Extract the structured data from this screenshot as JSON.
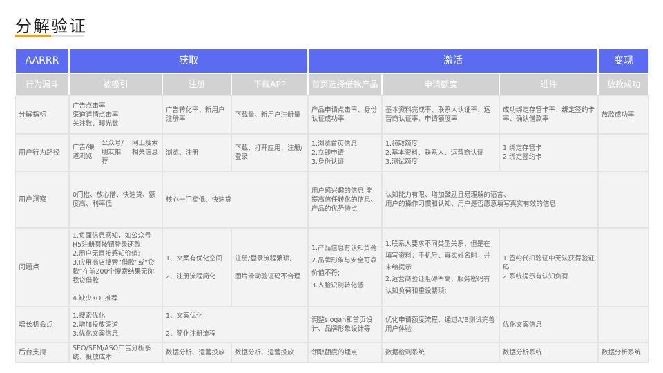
{
  "page": {
    "title": "分解验证"
  },
  "headers": {
    "col0": "AARRR",
    "acq": "获取",
    "act": "激活",
    "rev": "变现"
  },
  "subheaders": {
    "funnel": "行为漏斗",
    "attract": "被吸引",
    "register": "注册",
    "download": "下载APP",
    "home": "首页选择借款产品",
    "apply": "申请额度",
    "card": "进件",
    "loan": "放款成功"
  },
  "rows": {
    "metrics": {
      "label": "分解指标",
      "attract": "广告点击率\n渠道详情点击率\n关注数、曝光数",
      "register": "广告转化率、新用户注册率",
      "download": "下载量、新用户注册量",
      "home": "产品申请点击率、身份认证成功率",
      "apply": "基本资料完成率、联系人认证率、运营商认证率、申请额度率",
      "card": "成功绑定存管卡率、绑定签约卡率、确认借款率",
      "loan": "放款成功率"
    },
    "path": {
      "label": "用户行为路径",
      "attract_a": "广告/渠道浏览",
      "attract_b": "公众号/朋友推荐",
      "attract_c": "网上搜索相关信息",
      "register": "浏览、注册",
      "download": "下载、打开应用、注册/登录",
      "home": "1.浏览首页信息\n2.立即申请\n3.身份认证",
      "apply": "1.领取额度\n2.基本资料、联系人、运营商认证\n3.测试额度",
      "card": "1.绑定存管卡\n2.绑定签约卡",
      "loan": ""
    },
    "insight": {
      "label": "用户洞察",
      "attract": "0门槛、放心借、快速贷、额度高、利率低",
      "register_download": "核心一门槛低、快速贷",
      "home": "用户感兴趣的信息,能提高信任转化的信息、产品的优势特点",
      "apply_card": "认知能力有限、增加鼓励且易理解的语言、\n用户的操作习惯和认知、用户是否愿意填写真实有效的信息",
      "loan": ""
    },
    "problems": {
      "label": "问题点",
      "attract": "1.负面信息感知，如公众号H5注册页按钮登录还款;\n2.用户无直接感知价值;\n3.应用商店搜索“借款”或“贷款”在前200个搜索结果无你我贷借款\n\n4.缺少KOL推荐",
      "register": "1、文案有优化空间\n\n2、注册流程简化",
      "download": "注册/登录流程繁琐,\n\n图片滑动验证码不合理",
      "home": "1.产品信息有认知负荷\n2.品牌形象与安全可靠价值不符;\n3.人脸识别转化低",
      "apply": "1.联系人要求不同类型关系，但是在填写资料：手机号、真实姓名时，并未给提示\n2.运营商验证阻碍率高、服务密码有认知负荷和重设繁琐;",
      "card": "1.签约代扣验证中无法获得验证码\n2.系统提示有认知负荷",
      "loan": ""
    },
    "growth": {
      "label": "增长机会点",
      "attract": "1.搜索优化\n2.增加投放渠道\n3.优化文案信息",
      "register_download": "1、文案优化\n\n2、简化注册流程",
      "home": "调整slogan和首页设计、品牌形象设计等",
      "apply": "优化申请额度流程、通过A/B测试完善用户体验",
      "card": "优化文案信息",
      "loan": ""
    },
    "support": {
      "label": "后台支持",
      "attract": "SEO/SEM/ASO广告分析系统、投放成本",
      "register": "数据分析、运营投放",
      "download": "数据分析、运营投放",
      "home": "领取额度的埋点",
      "apply": "数据检测系统",
      "card": "数据分析系统",
      "loan": "数据分析系统"
    }
  },
  "colors": {
    "header": "#5b6cf2",
    "subheader": "#d2d2d2",
    "cell": "#f3f3f3",
    "accent": "#f0a020"
  }
}
